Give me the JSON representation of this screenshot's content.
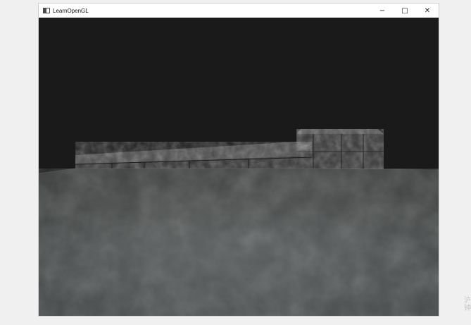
{
  "window": {
    "title": "LearnOpenGL",
    "controls": {
      "minimize": "−",
      "maximize": "□",
      "close": "✕"
    }
  },
  "scene": {
    "background_color": "#1a1a1a",
    "floor_colors": {
      "top": "#3a3c3b",
      "mid": "#545858",
      "bottom": "#4a4e4f"
    },
    "block_colors": {
      "face": "#363636",
      "top": "#505050",
      "dark": "#222222"
    }
  },
  "watermark": {
    "line1": "沪",
    "line2": "钟"
  }
}
